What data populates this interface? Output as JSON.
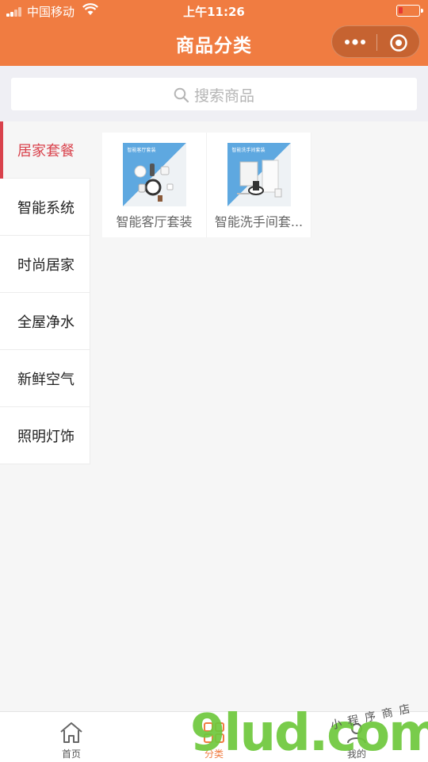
{
  "status_bar": {
    "carrier": "中国移动",
    "time": "上午11:26",
    "battery_level": 0.15
  },
  "nav": {
    "title": "商品分类",
    "menu_icon": "more-dots-icon",
    "close_icon": "miniprogram-close-icon"
  },
  "search": {
    "placeholder": "搜索商品"
  },
  "sidebar": {
    "items": [
      {
        "label": "居家套餐",
        "active": true
      },
      {
        "label": "智能系统",
        "active": false
      },
      {
        "label": "时尚居家",
        "active": false
      },
      {
        "label": "全屋净水",
        "active": false
      },
      {
        "label": "新鲜空气",
        "active": false
      },
      {
        "label": "照明灯饰",
        "active": false
      }
    ]
  },
  "products": [
    {
      "name": "智能客厅套装",
      "thumb_caption": "智能客厅套装"
    },
    {
      "name": "智能洗手间套...",
      "thumb_caption": "智能洗手间套装"
    }
  ],
  "tabbar": {
    "tabs": [
      {
        "label": "首页",
        "icon": "home-icon",
        "active": false
      },
      {
        "label": "分类",
        "icon": "grid-icon",
        "active": true
      },
      {
        "label": "我的",
        "icon": "user-icon",
        "active": false
      }
    ]
  },
  "watermark": {
    "text": "9lud.com",
    "tagline": "小程序商店"
  },
  "colors": {
    "brand": "#f07c41",
    "active_category": "#d9424c",
    "thumb_blue": "#5ea8e0"
  }
}
